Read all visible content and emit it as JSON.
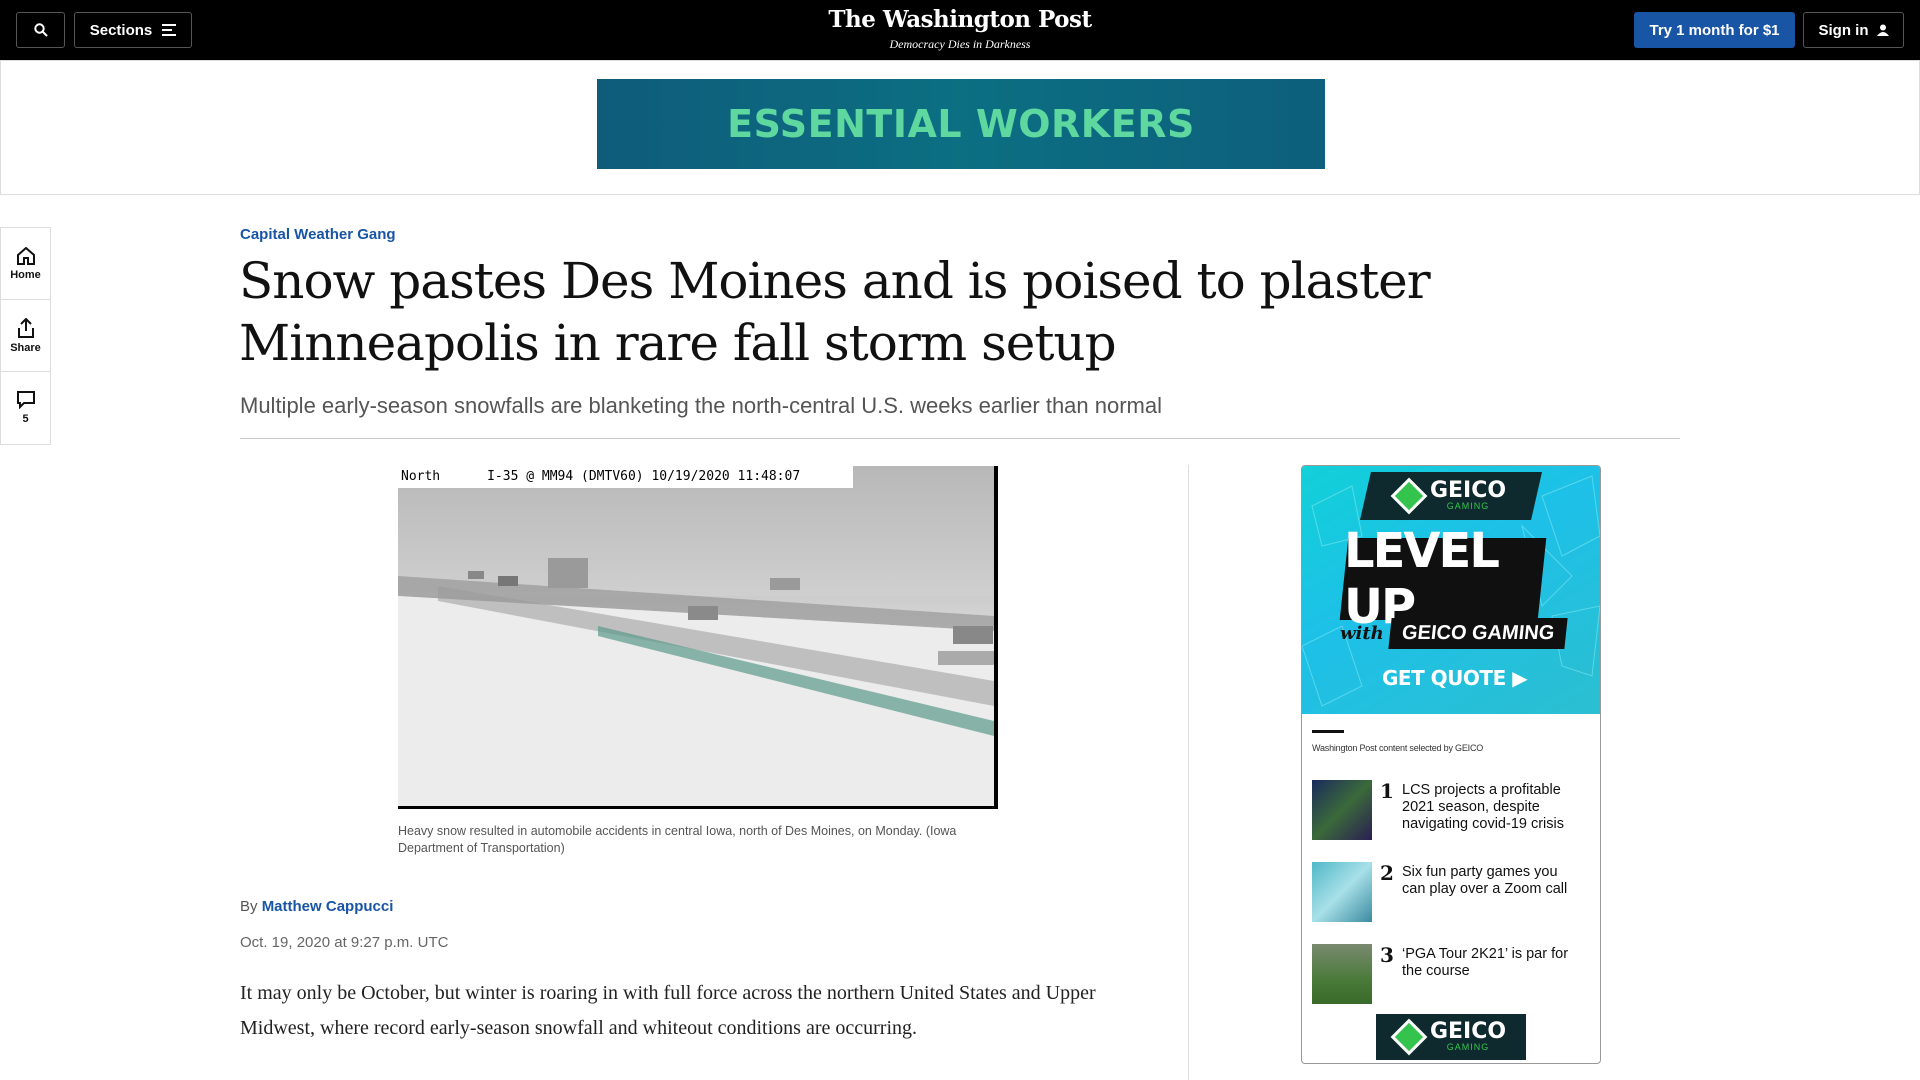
{
  "topbar": {
    "sections_label": "Sections",
    "logo": "The Washington Post",
    "tagline": "Democracy Dies in Darkness",
    "try_label": "Try 1 month for $1",
    "signin_label": "Sign in"
  },
  "ad_banner": {
    "text": "ESSENTIAL WORKERS"
  },
  "rail": {
    "home_label": "Home",
    "share_label": "Share",
    "comments_count": "5"
  },
  "article": {
    "kicker": "Capital Weather Gang",
    "headline": "Snow pastes Des Moines and is poised to plaster Minneapolis in rare fall storm setup",
    "subhead": "Multiple early-season snowfalls are blanketing the north-central U.S. weeks earlier than normal",
    "photo_overlay": "North      I-35 @ MM94 (DMTV60) 10/19/2020 11:48:07",
    "caption": "Heavy snow resulted in automobile accidents in central Iowa, north of Des Moines, on Monday. (Iowa Department of Transportation)",
    "by": "By",
    "author": "Matthew Cappucci",
    "date": "Oct. 19, 2020 at 9:27 p.m. UTC",
    "body": "It may only be October, but winter is roaring in with full force across the northern United States and Upper Midwest, where record early-season snowfall and whiteout conditions are occurring."
  },
  "side_ad": {
    "brand": "GEICO",
    "brand_sub": "GAMING",
    "level_up": "LEVEL UP",
    "with": "with",
    "geico_gaming": "GEICO GAMING",
    "get_quote": "GET QUOTE ▶",
    "selected_by": "Washington Post content selected by GEICO",
    "items": [
      {
        "num": "1",
        "text": "LCS projects a profitable 2021 season, despite navigating covid-19 crisis"
      },
      {
        "num": "2",
        "text": "Six fun party games you can play over a Zoom call"
      },
      {
        "num": "3",
        "text": "‘PGA Tour 2K21’ is par for the course"
      }
    ]
  }
}
